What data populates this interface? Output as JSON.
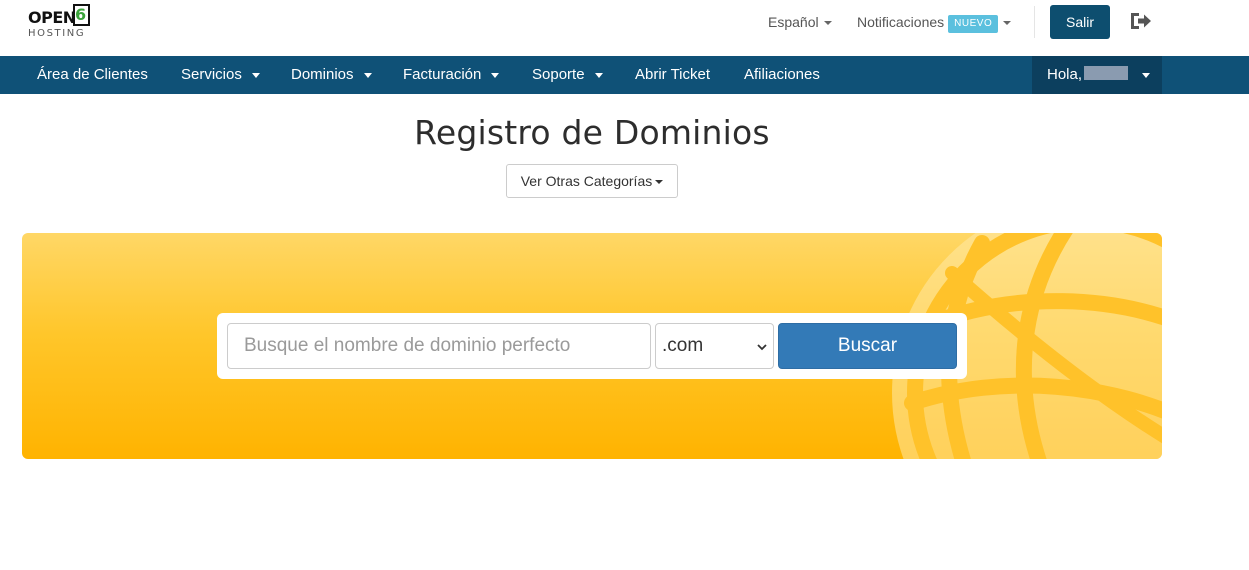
{
  "logo": {
    "main": "OPEN",
    "number": "6",
    "sub": "HOSTING"
  },
  "topbar": {
    "language": "Español",
    "notifications": "Notificaciones",
    "notifications_badge": "NUEVO",
    "logout_button": "Salir"
  },
  "nav": {
    "items": [
      {
        "label": "Área de Clientes",
        "dropdown": false
      },
      {
        "label": "Servicios",
        "dropdown": true
      },
      {
        "label": "Dominios",
        "dropdown": true
      },
      {
        "label": "Facturación",
        "dropdown": true
      },
      {
        "label": "Soporte",
        "dropdown": true
      },
      {
        "label": "Abrir Ticket",
        "dropdown": false
      },
      {
        "label": "Afiliaciones",
        "dropdown": false
      }
    ],
    "user_greeting": "Hola,"
  },
  "page": {
    "title": "Registro de Dominios",
    "categories_button": "Ver Otras Categorías"
  },
  "search": {
    "placeholder": "Busque el nombre de dominio perfecto",
    "tld_selected": ".com",
    "button": "Buscar"
  },
  "colors": {
    "nav_bg": "#0f5177",
    "nav_user_bg": "#0c3f5e",
    "logout_btn": "#0d4e6f",
    "search_btn": "#337ab7",
    "banner_top": "#ffd766",
    "banner_bottom": "#ffb300",
    "badge": "#5bc0de",
    "logo_accent": "#3aa33a"
  }
}
